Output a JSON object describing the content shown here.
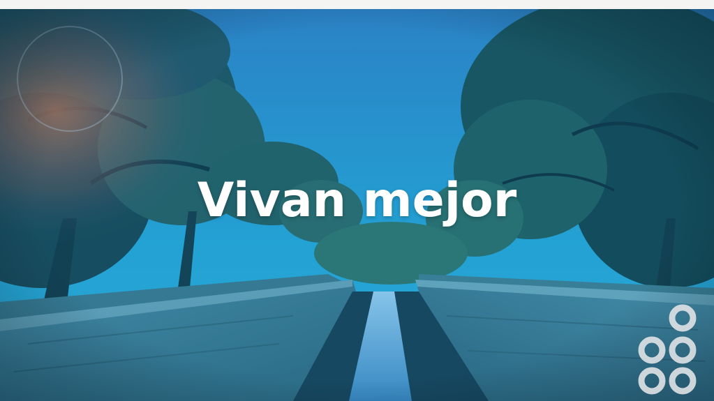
{
  "caption": {
    "text": "Vivan mejor"
  },
  "colors": {
    "sky_top": "#2f86c8",
    "sky_mid": "#27a9d6",
    "foliage_dark": "#0f3a3a",
    "foliage_mid": "#1f5f55",
    "warm_glow": "#c86a4a",
    "wall": "#3f7f8f",
    "water": "#7fb8e0",
    "logo_ring": "#d9dde0",
    "caption": "#ffffff"
  },
  "logo": {
    "icon": "rings-logo-icon"
  }
}
